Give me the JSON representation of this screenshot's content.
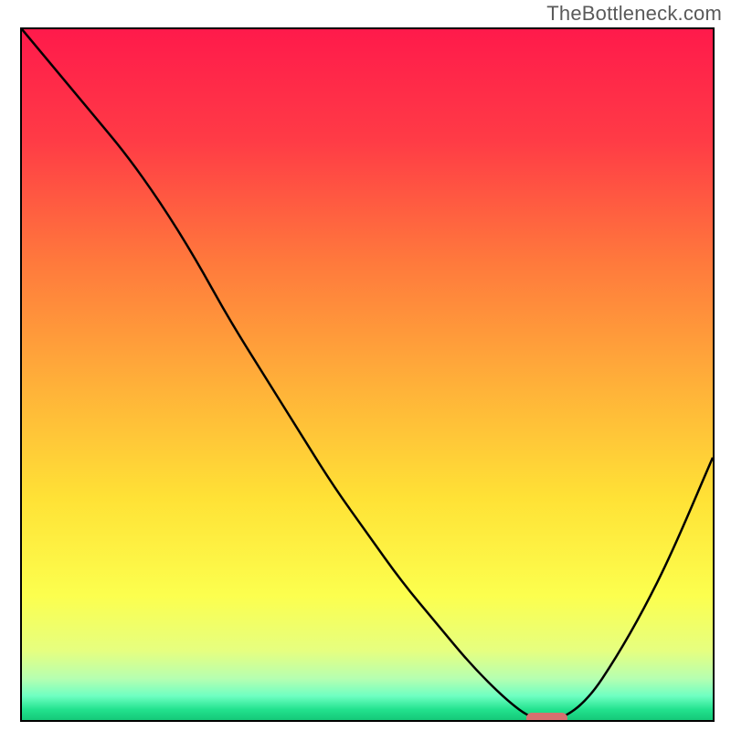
{
  "attribution": "TheBottleneck.com",
  "chart_data": {
    "type": "line",
    "title": "",
    "xlabel": "",
    "ylabel": "",
    "xlim": [
      0,
      100
    ],
    "ylim": [
      0,
      100
    ],
    "grid": false,
    "legend": false,
    "gradient_stops": [
      {
        "offset": 0.0,
        "color": "#ff1a4b"
      },
      {
        "offset": 0.16,
        "color": "#ff3b46"
      },
      {
        "offset": 0.34,
        "color": "#ff7a3c"
      },
      {
        "offset": 0.52,
        "color": "#ffb239"
      },
      {
        "offset": 0.68,
        "color": "#ffe236"
      },
      {
        "offset": 0.82,
        "color": "#fcff4e"
      },
      {
        "offset": 0.9,
        "color": "#e6ff80"
      },
      {
        "offset": 0.94,
        "color": "#b6ffb1"
      },
      {
        "offset": 0.965,
        "color": "#6fffc2"
      },
      {
        "offset": 0.985,
        "color": "#22e28e"
      },
      {
        "offset": 1.0,
        "color": "#15c878"
      }
    ],
    "series": [
      {
        "name": "bottleneck-curve",
        "x": [
          0,
          5,
          10,
          15,
          20,
          25,
          30,
          35,
          40,
          45,
          50,
          55,
          60,
          65,
          70,
          74,
          78,
          82,
          86,
          90,
          94,
          100
        ],
        "y": [
          100,
          94,
          88,
          82,
          75,
          67,
          58,
          50,
          42,
          34,
          27,
          20,
          14,
          8,
          3,
          0,
          0,
          3,
          9,
          16,
          24,
          38
        ]
      }
    ],
    "annotations": [
      {
        "name": "optimum-marker",
        "x_start": 73,
        "x_end": 79,
        "y": 0,
        "color": "#d6706f"
      }
    ]
  }
}
